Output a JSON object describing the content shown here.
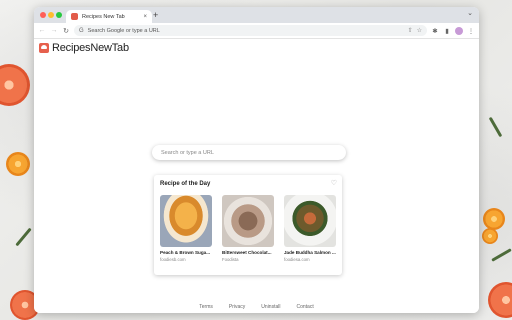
{
  "tab": {
    "title": "Recipes New Tab",
    "close": "×",
    "new_tab": "+"
  },
  "toolbar": {
    "back": "←",
    "forward": "→",
    "reload": "↻",
    "omnibox_placeholder": "Search Google or type a URL",
    "share": "⇧",
    "star": "☆",
    "extensions": "✱",
    "sidepanel": "▮",
    "menu": "⋮",
    "chevron": "⌄"
  },
  "logo": {
    "text": "RecipesNewTab"
  },
  "search": {
    "placeholder": "Search or type a URL"
  },
  "card": {
    "title": "Recipe of the Day",
    "heart": "♡",
    "recipes": [
      {
        "name": "Peach & Brown Suga...",
        "source": "foodiesb.com"
      },
      {
        "name": "Bittersweet Chocolat...",
        "source": "Foodista"
      },
      {
        "name": "Jade Buddha Salmon ...",
        "source": "foodiesa.com"
      }
    ]
  },
  "footer": {
    "links": [
      "Terms",
      "Privacy",
      "Uninstall",
      "Contact"
    ]
  },
  "icons": {
    "favicon": "chef-hat-icon",
    "logo": "chef-hat-icon",
    "search": "search-icon"
  },
  "colors": {
    "accent": "#e6604d",
    "window_bg": "#ffffff",
    "tabbar": "#dee1e6"
  }
}
